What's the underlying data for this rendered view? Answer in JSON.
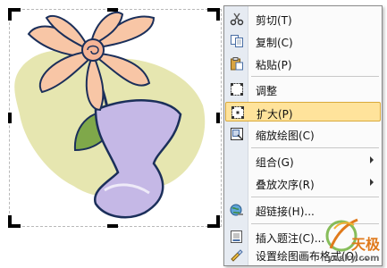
{
  "context_menu": {
    "items": [
      {
        "label": "剪切(T)",
        "icon": "scissors-icon"
      },
      {
        "label": "复制(C)",
        "icon": "copy-icon"
      },
      {
        "label": "粘贴(P)",
        "icon": "paste-icon"
      },
      {
        "label": "调整",
        "icon": "crop-adjust-icon"
      },
      {
        "label": "扩大(P)",
        "icon": "expand-icon",
        "highlighted": true
      },
      {
        "label": "缩放绘图(C)",
        "icon": "scale-drawing-icon"
      },
      {
        "label": "组合(G)",
        "submenu": true
      },
      {
        "label": "叠放次序(R)",
        "submenu": true
      },
      {
        "label": "超链接(H)...",
        "icon": "hyperlink-globe-icon"
      },
      {
        "label": "插入题注(C)...",
        "icon": "insert-caption-icon"
      },
      {
        "label": "设置绘图画布格式(O)...",
        "icon": "format-canvas-icon"
      }
    ]
  },
  "watermark": {
    "brand": "天极",
    "url": "yesky.com"
  },
  "colors": {
    "menu_highlight": "#ffe39b",
    "menu_strip": "#e6ebf2",
    "petal": "#f8c6a6",
    "vase": "#c5b8e6",
    "background_blob": "#e6e6b0"
  }
}
